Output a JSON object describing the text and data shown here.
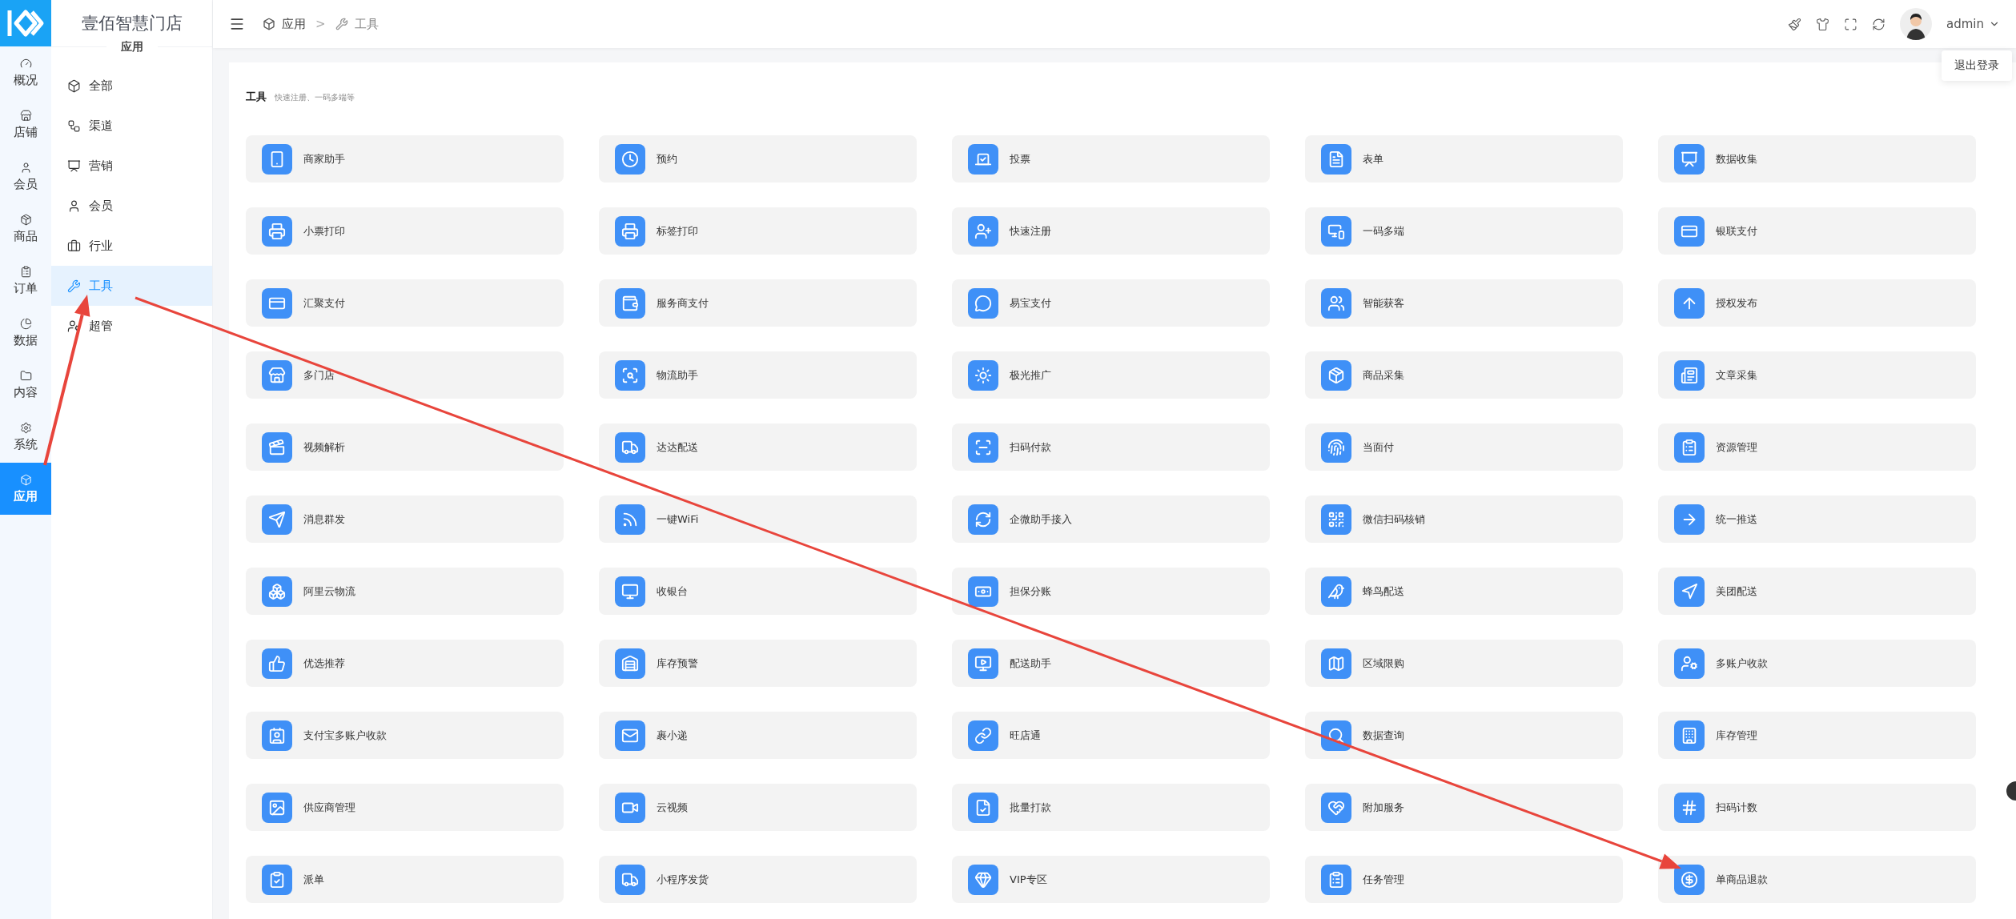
{
  "rail": [
    {
      "label": "概况",
      "selected": false
    },
    {
      "label": "店铺",
      "selected": false
    },
    {
      "label": "会员",
      "selected": false
    },
    {
      "label": "商品",
      "selected": false
    },
    {
      "label": "订单",
      "selected": false
    },
    {
      "label": "数据",
      "selected": false
    },
    {
      "label": "内容",
      "selected": false
    },
    {
      "label": "系统",
      "selected": false
    },
    {
      "label": "应用",
      "selected": true
    }
  ],
  "store_title": "壹佰智慧门店",
  "section_title": "应用",
  "menu": [
    {
      "label": "全部",
      "selected": false
    },
    {
      "label": "渠道",
      "selected": false
    },
    {
      "label": "营销",
      "selected": false
    },
    {
      "label": "会员",
      "selected": false
    },
    {
      "label": "行业",
      "selected": false
    },
    {
      "label": "工具",
      "selected": true
    },
    {
      "label": "超管",
      "selected": false
    }
  ],
  "breadcrumb": [
    {
      "label": "应用"
    },
    {
      "label": "工具"
    }
  ],
  "breadcrumb_separator": ">",
  "user": {
    "name": "admin"
  },
  "user_menu": [
    {
      "label": "退出登录"
    }
  ],
  "panel": {
    "title": "工具",
    "subtitle": "快速注册、一码多端等"
  },
  "tools": [
    "商家助手",
    "预约",
    "投票",
    "表单",
    "数据收集",
    "小票打印",
    "标签打印",
    "快速注册",
    "一码多端",
    "银联支付",
    "汇聚支付",
    "服务商支付",
    "易宝支付",
    "智能获客",
    "授权发布",
    "多门店",
    "物流助手",
    "极光推广",
    "商品采集",
    "文章采集",
    "视频解析",
    "达达配送",
    "扫码付款",
    "当面付",
    "资源管理",
    "消息群发",
    "一键WiFi",
    "企微助手接入",
    "微信扫码核销",
    "统一推送",
    "阿里云物流",
    "收银台",
    "担保分账",
    "蜂鸟配送",
    "美团配送",
    "优选推荐",
    "库存预警",
    "配送助手",
    "区域限购",
    "多账户收款",
    "支付宝多账户收款",
    "裹小递",
    "旺店通",
    "数据查询",
    "库存管理",
    "供应商管理",
    "云视频",
    "批量打款",
    "附加服务",
    "扫码计数",
    "派单",
    "小程序发货",
    "VIP专区",
    "任务管理",
    "单商品退款"
  ]
}
